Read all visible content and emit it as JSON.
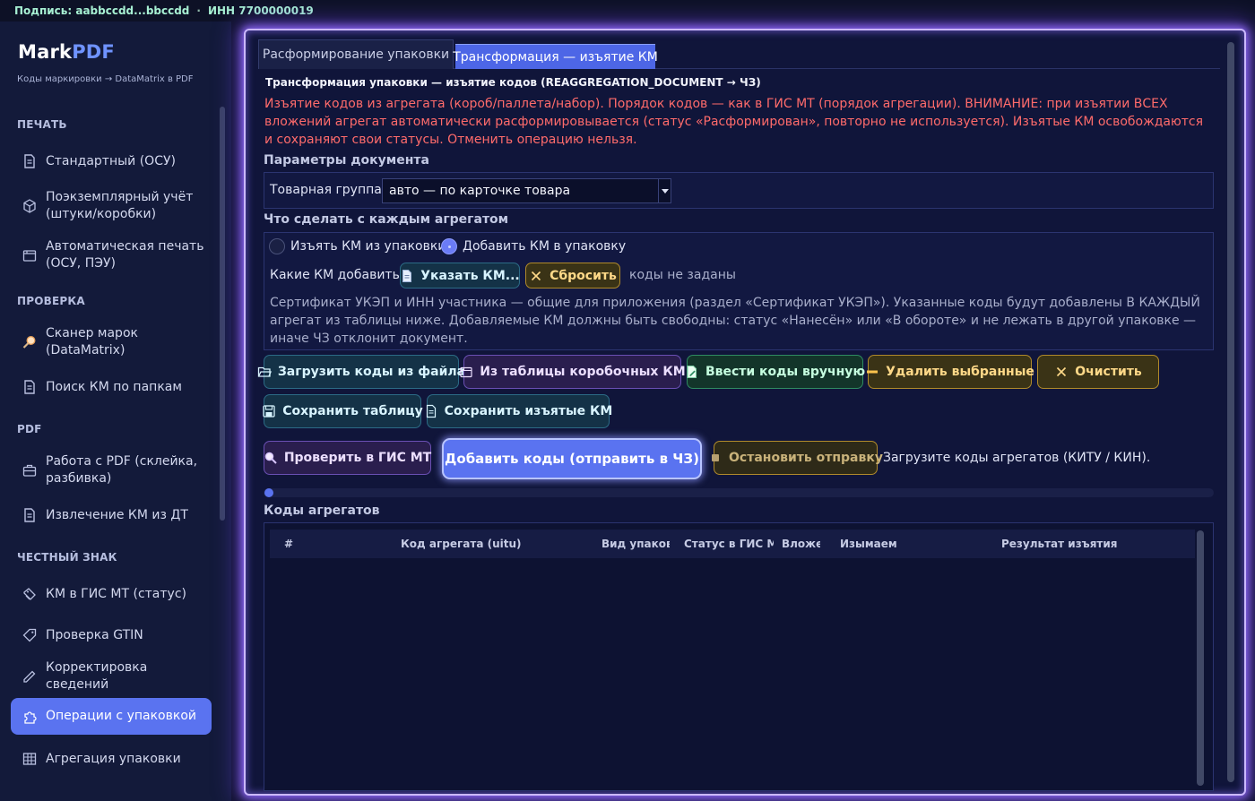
{
  "status_bar": {
    "signature": "Подпись: aabbccdd...bbccdd",
    "separator": "·",
    "inn": "ИНН 7700000019"
  },
  "brand": {
    "name_part1": "Mark",
    "name_part2": "PDF",
    "tagline": "Коды маркировки → DataMatrix в PDF"
  },
  "sidebar": {
    "sections": {
      "print": "ПЕЧАТЬ",
      "check": "ПРОВЕРКА",
      "pdf": "PDF",
      "honest_sign": "ЧЕСТНЫЙ ЗНАК"
    },
    "items": [
      {
        "label": "Стандартный (ОСУ)",
        "icon": "document-icon"
      },
      {
        "label": "Поэкземплярный учёт (штуки/коробки)",
        "icon": "cube-icon"
      },
      {
        "label": "Автоматическая печать (ОСУ, ПЭУ)",
        "icon": "folder-icon"
      },
      {
        "label": "Сканер марок (DataMatrix)",
        "icon": "magnifier-icon"
      },
      {
        "label": "Поиск КМ по папкам",
        "icon": "document-icon"
      },
      {
        "label": "Работа с PDF (склейка, разбивка)",
        "icon": "briefcase-icon"
      },
      {
        "label": "Извлечение КМ из ДТ",
        "icon": "document-icon"
      },
      {
        "label": "КМ в ГИС МТ (статус)",
        "icon": "tag-stack-icon"
      },
      {
        "label": "Проверка GTIN",
        "icon": "tag-icon"
      },
      {
        "label": "Корректировка сведений",
        "icon": "pencil-icon"
      },
      {
        "label": "Операции с упаковкой",
        "icon": "puzzle-icon"
      },
      {
        "label": "Агрегация упаковки",
        "icon": "grid-icon"
      }
    ],
    "active_item": "Операции с упаковкой"
  },
  "tabs": [
    {
      "label": "Расформирование упаковки",
      "active": false
    },
    {
      "label": "Трансформация — изъятие КМ",
      "active": true
    }
  ],
  "content": {
    "doc_title": "Трансформация упаковки — изъятие кодов (REAGGREGATION_DOCUMENT → ЧЗ)",
    "warning": "Изъятие кодов из агрегата (короб/паллета/набор). Порядок кодов — как в ГИС МТ (порядок агрегации). ВНИМАНИЕ: при изъятии ВСЕХ вложений агрегат автоматически расформировывается (статус «Расформирован», повторно не используется). Изъятые КМ освобождаются и сохраняют свои статусы. Отменить операцию нельзя.",
    "params_title": "Параметры документа",
    "product_group_label": "Товарная группа:",
    "product_group_value": "авто — по карточке товара",
    "action_title": "Что сделать с каждым агрегатом",
    "radio_remove": "Изъять КМ из упаковки",
    "radio_add": "Добавить КМ в упаковку",
    "radio_selected": "add",
    "which_km_label": "Какие КМ добавить:",
    "specify_button": "Указать КМ...",
    "reset_button": "Сбросить",
    "codes_status": "коды не заданы",
    "note": "Сертификат УКЭП и ИНН участника — общие для приложения (раздел «Сертификат УКЭП»). Указанные коды будут добавлены В КАЖДЫЙ агрегат из таблицы ниже. Добавляемые КМ должны быть свободны: статус «Нанесён» или «В обороте» и не лежать в другой упаковке — иначе ЧЗ отклонит документ.",
    "buttons": {
      "load_file": "Загрузить коды из файла",
      "from_box_table": "Из таблицы коробочных КМ",
      "enter_manually": "Ввести коды вручную",
      "delete_selected": "Удалить выбранные",
      "clear": "Очистить",
      "save_table": "Сохранить таблицу",
      "save_removed": "Сохранить изъятые КМ",
      "check_gis": "Проверить в ГИС МТ",
      "submit": "Добавить коды (отправить в ЧЗ)",
      "stop": "Остановить отправку"
    },
    "hint": "Загрузите коды агрегатов (КИТУ / КИН).",
    "progress": 0.0,
    "table_title": "Коды агрегатов",
    "table_columns": [
      "#",
      "Код агрегата (uitu)",
      "Вид упаковки",
      "Статус в ГИС МТ",
      "Вложен",
      "Изымаем",
      "Результат изъятия"
    ],
    "table_rows": []
  }
}
